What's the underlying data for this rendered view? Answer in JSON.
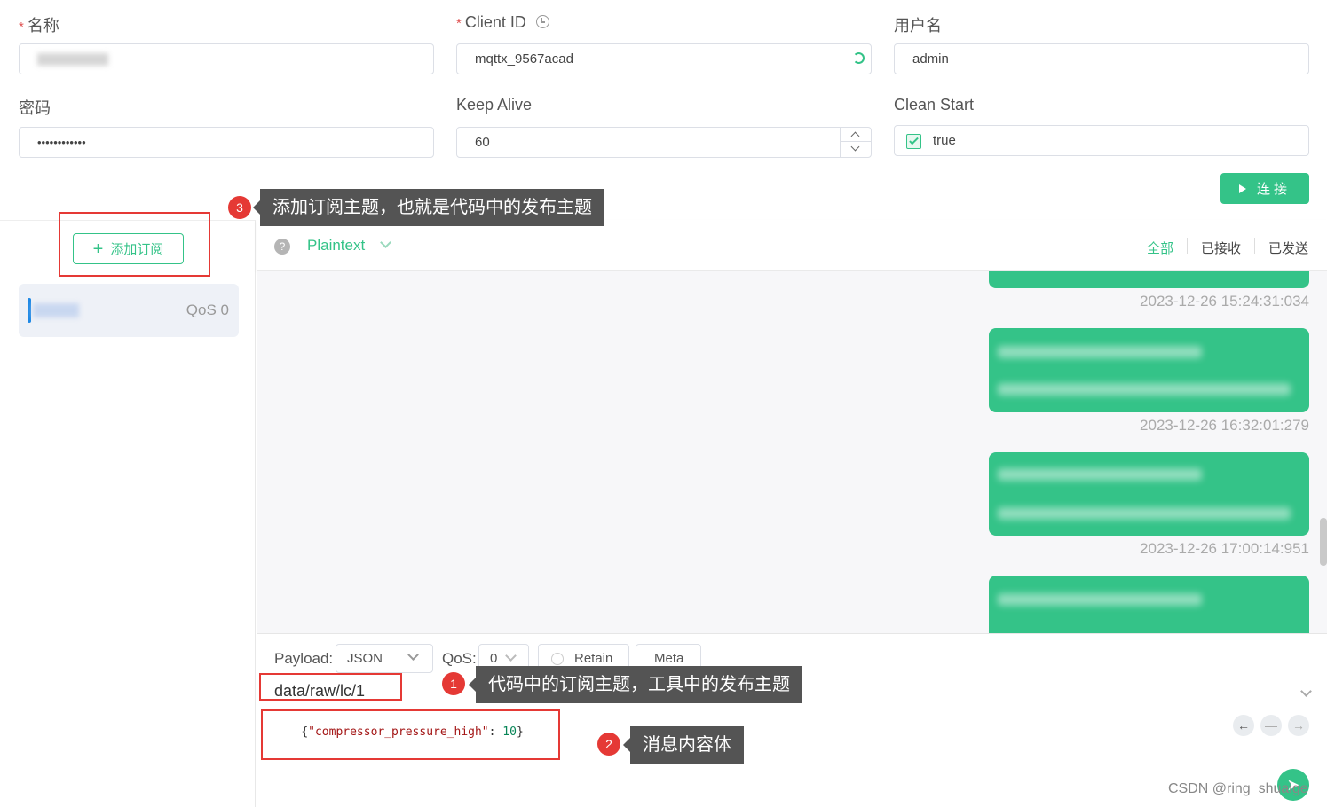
{
  "form": {
    "name_label": "名称",
    "client_id_label": "Client ID",
    "client_id_value": "mqttx_9567acad",
    "username_label": "用户名",
    "username_value": "admin",
    "password_label": "密码",
    "password_value": "••••••••••••",
    "keep_alive_label": "Keep Alive",
    "keep_alive_value": "60",
    "clean_start_label": "Clean Start",
    "clean_start_value": "true",
    "connect_label": "连接"
  },
  "subscriptions": {
    "add_label": "添加订阅",
    "items": [
      {
        "qos": "QoS 0"
      }
    ]
  },
  "messages": {
    "payload_format": "Plaintext",
    "filters": {
      "all": "全部",
      "received": "已接收",
      "sent": "已发送"
    },
    "timestamps": [
      "2023-12-26 15:24:31:034",
      "2023-12-26 16:32:01:279",
      "2023-12-26 17:00:14:951"
    ]
  },
  "composer": {
    "payload_label": "Payload:",
    "payload_type": "JSON",
    "qos_label": "QoS:",
    "qos_value": "0",
    "retain_label": "Retain",
    "meta_label": "Meta",
    "topic": "data/raw/lc/1",
    "body_open": "{",
    "body_key": "\"compressor_pressure_high\"",
    "body_colon": ": ",
    "body_value": "10",
    "body_close": "}"
  },
  "annotations": [
    {
      "number": "1",
      "text": "代码中的订阅主题，工具中的发布主题"
    },
    {
      "number": "2",
      "text": "消息内容体"
    },
    {
      "number": "3",
      "text": "添加订阅主题，也就是代码中的发布主题"
    }
  ],
  "watermark": "CSDN @ring_shuaige",
  "colors": {
    "accent": "#34c388",
    "annotation": "#e53935",
    "tooltip": "#545454"
  }
}
